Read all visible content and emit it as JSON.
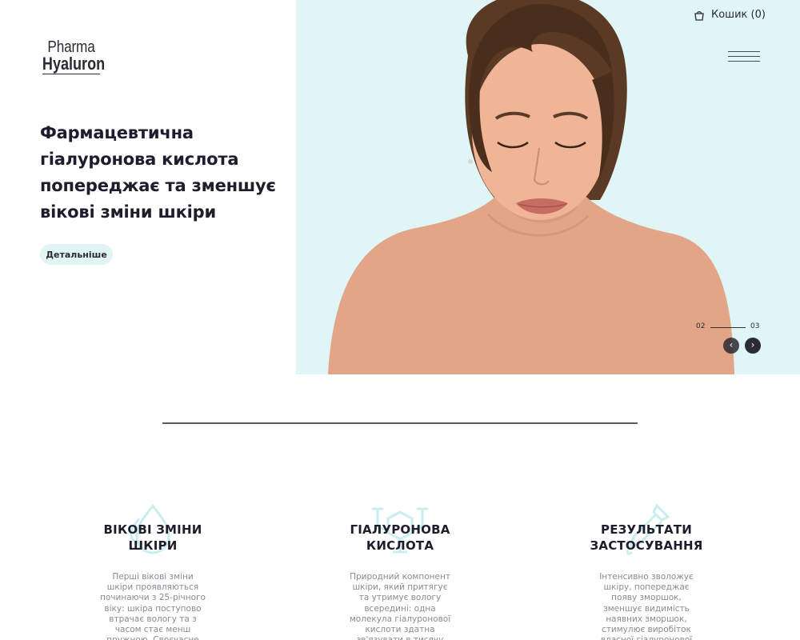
{
  "logo": {
    "line1": "Pharma",
    "line2": "Hyaluron"
  },
  "header": {
    "cart_label": "Кошик (0)"
  },
  "hero": {
    "headline": "Фармацевтична гіалуронова кислота попереджає та зменшує вікові зміни шкіри",
    "cta_label": "Детальніше",
    "slide_current": "02",
    "slide_total": "03"
  },
  "features": [
    {
      "title": "ВІКОВІ ЗМІНИ ШКІРИ",
      "text": "Перші вікові зміни шкіри проявляються починаючи з 25-річного віку: шкіра поступово втрачає вологу та з часом стає менш пружною. Своєчасне",
      "icon": "drops-icon"
    },
    {
      "title": "ГІАЛУРОНОВА КИСЛОТА",
      "text": "Природний компонент шкіри, який притягує та утримує вологу всередині: одна молекула гіалуронової кислоти здатна зв'язувати в тисячу",
      "icon": "molecule-icon"
    },
    {
      "title": "РЕЗУЛЬТАТИ ЗАСТОСУВАННЯ",
      "text": "Інтенсивно зволожує шкіру, попереджає появу зморшок, зменшує видимість наявних зморшок, стимулює виробіток власної гіалуронової кислоти в",
      "icon": "dropper-icon"
    }
  ],
  "colors": {
    "hero_bg": "#e0f5f6",
    "button_bg": "#e2f5f5",
    "text_dark": "#1e1d2c",
    "text_muted": "#8a8a92",
    "icon_tint": "#c9eef0"
  }
}
